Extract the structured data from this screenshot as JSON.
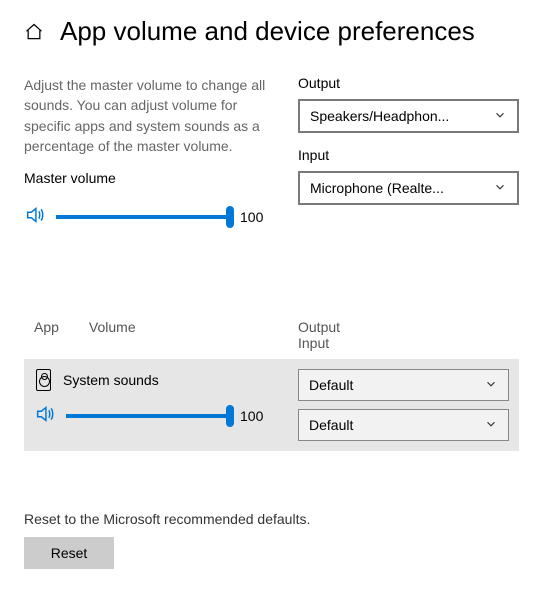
{
  "header": {
    "title": "App volume and device preferences"
  },
  "description": "Adjust the master volume to change all sounds. You can adjust volume for specific apps and system sounds as a percentage of the master volume.",
  "master": {
    "label": "Master volume",
    "value": "100",
    "percent": 100
  },
  "output": {
    "label": "Output",
    "selected": "Speakers/Headphon..."
  },
  "input": {
    "label": "Input",
    "selected": "Microphone (Realte..."
  },
  "columns": {
    "app": "App",
    "volume": "Volume",
    "output": "Output",
    "input": "Input"
  },
  "app_rows": [
    {
      "name": "System sounds",
      "volume_value": "100",
      "volume_percent": 100,
      "output_selected": "Default",
      "input_selected": "Default"
    }
  ],
  "reset": {
    "text": "Reset to the Microsoft recommended defaults.",
    "button": "Reset"
  }
}
